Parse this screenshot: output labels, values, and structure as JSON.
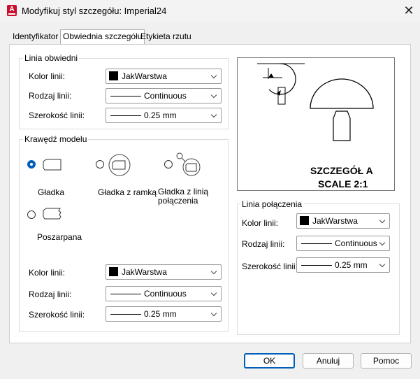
{
  "window": {
    "title": "Modyfikuj styl szczegółu: Imperial24"
  },
  "tabs": [
    {
      "label": "Identyfikator"
    },
    {
      "label": "Obwiednia szczegółu"
    },
    {
      "label": "Etykieta rzutu"
    }
  ],
  "boundary": {
    "group_label": "Linia obwiedni",
    "color_label": "Kolor linii:",
    "color_value": "JakWarstwa",
    "type_label": "Rodzaj linii:",
    "type_value": "Continuous",
    "weight_label": "Szerokość linii:",
    "weight_value": "0.25 mm"
  },
  "model_edge": {
    "group_label": "Krawędź modelu",
    "options": [
      {
        "label": "Gładka",
        "selected": true
      },
      {
        "label": "Gładka z ramką",
        "selected": false
      },
      {
        "label": "Gładka z linią połączenia",
        "selected": false
      },
      {
        "label": "Poszarpana",
        "selected": false
      }
    ],
    "color_label": "Kolor linii:",
    "color_value": "JakWarstwa",
    "type_label": "Rodzaj linii:",
    "type_value": "Continuous",
    "weight_label": "Szerokość linii:",
    "weight_value": "0.25 mm"
  },
  "preview": {
    "line1": "SZCZEGÓŁ A",
    "line2": "SCALE 2:1"
  },
  "connection": {
    "group_label": "Linia połączenia",
    "color_label": "Kolor linii:",
    "color_value": "JakWarstwa",
    "type_label": "Rodzaj linii:",
    "type_value": "Continuous",
    "weight_label": "Szerokość linii:",
    "weight_value": "0.25 mm"
  },
  "buttons": {
    "ok": "OK",
    "cancel": "Anuluj",
    "help": "Pomoc"
  },
  "colors": {
    "accent": "#005fb8",
    "app_icon": "#c8102e"
  }
}
